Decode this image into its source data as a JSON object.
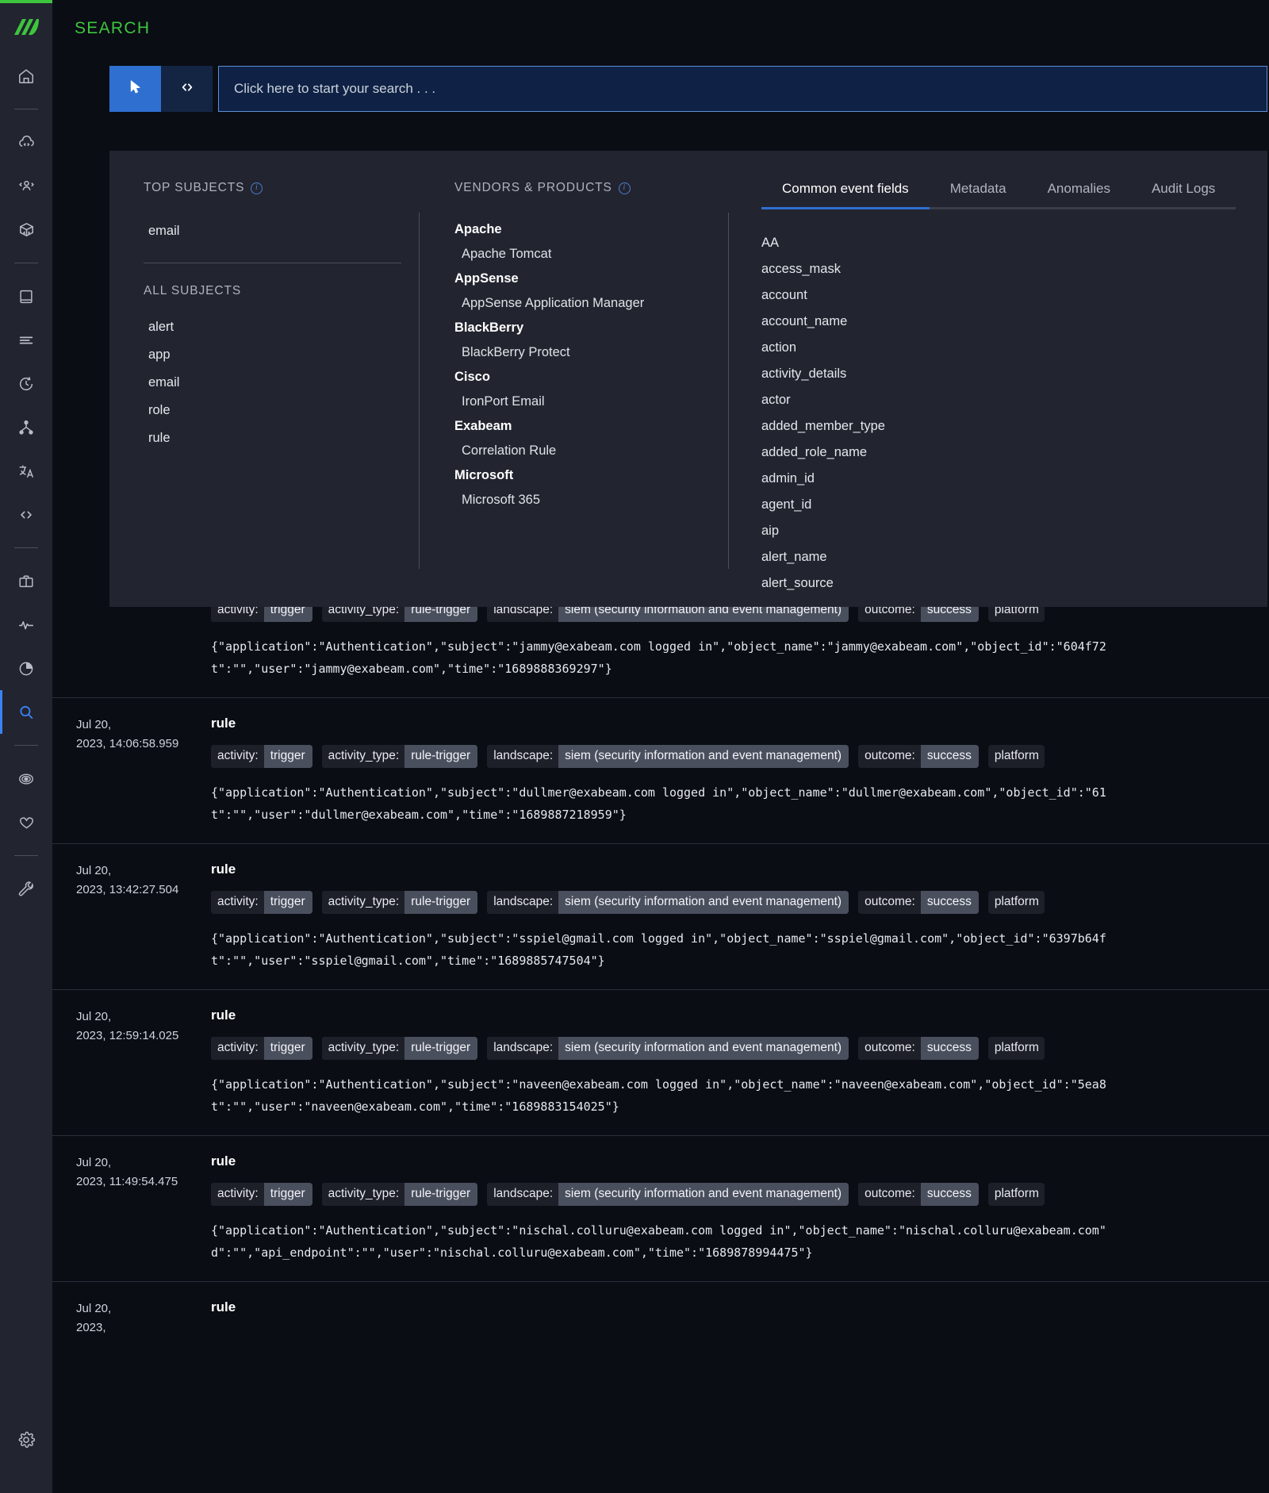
{
  "app": {
    "page_title": "SEARCH",
    "logo": "exabeam-logo",
    "accent_green": "#3ec53e",
    "accent_blue": "#2f6fd0"
  },
  "sidebar": {
    "items": [
      {
        "name": "home",
        "icon": "home-icon",
        "active": false
      },
      {
        "sep": true
      },
      {
        "name": "cloud-connectors",
        "icon": "cloud-code-icon",
        "active": false
      },
      {
        "name": "user-engagement",
        "icon": "user-code-icon",
        "active": false
      },
      {
        "name": "content-library",
        "icon": "box-code-icon",
        "active": false
      },
      {
        "sep": true
      },
      {
        "name": "collectors",
        "icon": "book-icon",
        "active": false
      },
      {
        "name": "log-stream",
        "icon": "lines-icon",
        "active": false
      },
      {
        "name": "history",
        "icon": "clock-rotate-icon",
        "active": false
      },
      {
        "name": "parsers",
        "icon": "sitemap-icon",
        "active": false
      },
      {
        "name": "language",
        "icon": "translate-icon",
        "active": false
      },
      {
        "name": "developer",
        "icon": "code-brackets-icon",
        "active": false
      },
      {
        "sep": true
      },
      {
        "name": "case-manager",
        "icon": "briefcase-icon",
        "active": false
      },
      {
        "name": "activity",
        "icon": "pulse-icon",
        "active": false
      },
      {
        "name": "reports",
        "icon": "pie-chart-icon",
        "active": false
      },
      {
        "name": "search",
        "icon": "magnifier-icon",
        "active": true
      },
      {
        "sep": true
      },
      {
        "name": "threat-center",
        "icon": "target-icon",
        "active": false
      },
      {
        "name": "health",
        "icon": "heart-icon",
        "active": false
      },
      {
        "sep": true
      },
      {
        "name": "settings-tools",
        "icon": "wrench-icon",
        "active": false
      }
    ],
    "bottom": {
      "name": "settings",
      "icon": "gear-icon"
    }
  },
  "search": {
    "mode_pointer_icon": "cursor-arrow-icon",
    "mode_code_icon": "angle-brackets-icon",
    "placeholder": "Click here to start your search . . .",
    "value": ""
  },
  "panel": {
    "subjects": {
      "top_header": "TOP SUBJECTS",
      "top_info_icon": "info-icon",
      "top_items": [
        "email"
      ],
      "all_header": "ALL SUBJECTS",
      "all_items": [
        "alert",
        "app",
        "email",
        "role",
        "rule"
      ]
    },
    "vendors": {
      "header": "VENDORS & PRODUCTS",
      "info_icon": "info-icon",
      "groups": [
        {
          "vendor": "Apache",
          "products": [
            "Apache Tomcat"
          ]
        },
        {
          "vendor": "AppSense",
          "products": [
            "AppSense Application Manager"
          ]
        },
        {
          "vendor": "BlackBerry",
          "products": [
            "BlackBerry Protect"
          ]
        },
        {
          "vendor": "Cisco",
          "products": [
            "IronPort Email"
          ]
        },
        {
          "vendor": "Exabeam",
          "products": [
            "Correlation Rule"
          ]
        },
        {
          "vendor": "Microsoft",
          "products": [
            "Microsoft 365"
          ]
        }
      ]
    },
    "fields": {
      "tabs": [
        {
          "label": "Common event fields",
          "active": true
        },
        {
          "label": "Metadata",
          "active": false
        },
        {
          "label": "Anomalies",
          "active": false
        },
        {
          "label": "Audit Logs",
          "active": false
        }
      ],
      "items": [
        "AA",
        "access_mask",
        "account",
        "account_name",
        "action",
        "activity_details",
        "actor",
        "added_member_type",
        "added_role_name",
        "admin_id",
        "agent_id",
        "aip",
        "alert_name",
        "alert_source"
      ]
    }
  },
  "results": {
    "rows": [
      {
        "timestamp": "",
        "title": "",
        "chips": [
          {
            "key": "activity:",
            "value": "trigger"
          },
          {
            "key": "activity_type:",
            "value": "rule-trigger"
          },
          {
            "key": "landscape:",
            "value": "siem (security information and event management)"
          },
          {
            "key": "outcome:",
            "value": "success"
          },
          {
            "key": "platform",
            "value": ""
          }
        ],
        "raw_line1": "{\"application\":\"Authentication\",\"subject\":\"jammy@exabeam.com logged in\",\"object_name\":\"jammy@exabeam.com\",\"object_id\":\"604f72",
        "raw_line2": "t\":\"\",\"user\":\"jammy@exabeam.com\",\"time\":\"1689888369297\"}"
      },
      {
        "timestamp": "Jul 20, 2023, 14:06:58.959",
        "title": "rule",
        "chips": [
          {
            "key": "activity:",
            "value": "trigger"
          },
          {
            "key": "activity_type:",
            "value": "rule-trigger"
          },
          {
            "key": "landscape:",
            "value": "siem (security information and event management)"
          },
          {
            "key": "outcome:",
            "value": "success"
          },
          {
            "key": "platform",
            "value": ""
          }
        ],
        "raw_line1": "{\"application\":\"Authentication\",\"subject\":\"dullmer@exabeam.com logged in\",\"object_name\":\"dullmer@exabeam.com\",\"object_id\":\"61",
        "raw_line2": "t\":\"\",\"user\":\"dullmer@exabeam.com\",\"time\":\"1689887218959\"}"
      },
      {
        "timestamp": "Jul 20, 2023, 13:42:27.504",
        "title": "rule",
        "chips": [
          {
            "key": "activity:",
            "value": "trigger"
          },
          {
            "key": "activity_type:",
            "value": "rule-trigger"
          },
          {
            "key": "landscape:",
            "value": "siem (security information and event management)"
          },
          {
            "key": "outcome:",
            "value": "success"
          },
          {
            "key": "platform",
            "value": ""
          }
        ],
        "raw_line1": "{\"application\":\"Authentication\",\"subject\":\"sspiel@gmail.com logged in\",\"object_name\":\"sspiel@gmail.com\",\"object_id\":\"6397b64f",
        "raw_line2": "t\":\"\",\"user\":\"sspiel@gmail.com\",\"time\":\"1689885747504\"}"
      },
      {
        "timestamp": "Jul 20, 2023, 12:59:14.025",
        "title": "rule",
        "chips": [
          {
            "key": "activity:",
            "value": "trigger"
          },
          {
            "key": "activity_type:",
            "value": "rule-trigger"
          },
          {
            "key": "landscape:",
            "value": "siem (security information and event management)"
          },
          {
            "key": "outcome:",
            "value": "success"
          },
          {
            "key": "platform",
            "value": ""
          }
        ],
        "raw_line1": "{\"application\":\"Authentication\",\"subject\":\"naveen@exabeam.com logged in\",\"object_name\":\"naveen@exabeam.com\",\"object_id\":\"5ea8",
        "raw_line2": "t\":\"\",\"user\":\"naveen@exabeam.com\",\"time\":\"1689883154025\"}"
      },
      {
        "timestamp": "Jul 20, 2023, 11:49:54.475",
        "title": "rule",
        "chips": [
          {
            "key": "activity:",
            "value": "trigger"
          },
          {
            "key": "activity_type:",
            "value": "rule-trigger"
          },
          {
            "key": "landscape:",
            "value": "siem (security information and event management)"
          },
          {
            "key": "outcome:",
            "value": "success"
          },
          {
            "key": "platform",
            "value": ""
          }
        ],
        "raw_line1": "{\"application\":\"Authentication\",\"subject\":\"nischal.colluru@exabeam.com logged in\",\"object_name\":\"nischal.colluru@exabeam.com\"",
        "raw_line2": "d\":\"\",\"api_endpoint\":\"\",\"user\":\"nischal.colluru@exabeam.com\",\"time\":\"1689878994475\"}"
      },
      {
        "timestamp": "Jul 20, 2023,",
        "title": "rule",
        "chips": [],
        "raw_line1": "",
        "raw_line2": ""
      }
    ]
  }
}
